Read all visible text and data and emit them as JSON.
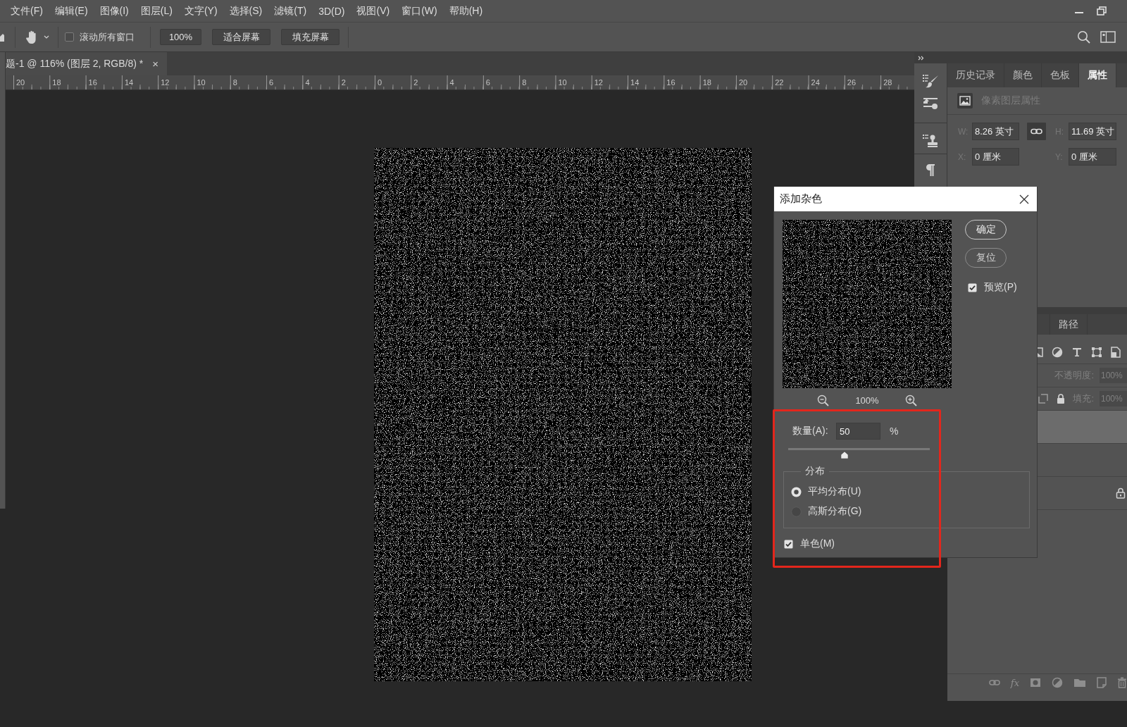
{
  "menu_bar": {
    "items": [
      "文件(F)",
      "编辑(E)",
      "图像(I)",
      "图层(L)",
      "文字(Y)",
      "选择(S)",
      "滤镜(T)",
      "3D(D)",
      "视图(V)",
      "窗口(W)",
      "帮助(H)"
    ]
  },
  "options_bar": {
    "scroll_all_windows": {
      "label": "滚动所有窗口",
      "checked": false
    },
    "buttons": [
      "100%",
      "适合屏幕",
      "填充屏幕"
    ]
  },
  "document_tab": {
    "title": "题-1 @ 116% (图层 2, RGB/8) *",
    "close": "×"
  },
  "ruler": {
    "labels": [
      "20",
      "18",
      "16",
      "14",
      "12",
      "10",
      "8",
      "6",
      "4",
      "2",
      "0",
      "2",
      "4",
      "6",
      "8",
      "10",
      "12",
      "14",
      "16",
      "18",
      "20",
      "22",
      "24",
      "26",
      "28"
    ]
  },
  "properties_panel": {
    "tabs": [
      {
        "label": "历史记录",
        "selected": false
      },
      {
        "label": "颜色",
        "selected": false
      },
      {
        "label": "色板",
        "selected": false
      },
      {
        "label": "属性",
        "selected": true
      }
    ],
    "heading": "像素图层属性",
    "fields": [
      {
        "label": "W:",
        "value": "8.26 英寸"
      },
      {
        "label": "H:",
        "value": "11.69 英寸"
      },
      {
        "label": "X:",
        "value": "0 厘米"
      },
      {
        "label": "Y:",
        "value": "0 厘米"
      }
    ]
  },
  "layers_panel": {
    "tabs": [
      {
        "label": "路径",
        "selected": false
      }
    ],
    "opacity": {
      "label": "不透明度:",
      "value": "100%",
      "disabled": true
    },
    "fill": {
      "label": "填充:",
      "value": "100%",
      "disabled": true
    },
    "layers": [
      {
        "selected": true,
        "locked": false
      },
      {
        "selected": false,
        "locked": false
      },
      {
        "selected": false,
        "locked": true
      }
    ],
    "effects_label": "fx"
  },
  "dialog": {
    "title": "添加杂色",
    "buttons": [
      "确定",
      "复位"
    ],
    "preview": {
      "label": "预览(P)",
      "checked": true
    },
    "zoom": "100%",
    "amount": {
      "label": "数量(A):",
      "value": "50",
      "unit": "%",
      "level": 0.4
    },
    "distribution": {
      "legend": "分布",
      "options": [
        {
          "label": "平均分布(U)",
          "selected": true
        },
        {
          "label": "高斯分布(G)",
          "selected": false
        }
      ]
    },
    "monochromatic": {
      "label": "单色(M)",
      "checked": true
    }
  }
}
